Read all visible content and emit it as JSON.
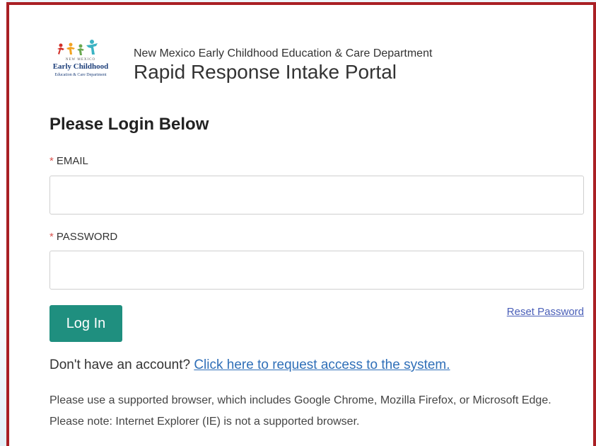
{
  "header": {
    "department": "New Mexico Early Childhood Education & Care Department",
    "portal_title": "Rapid Response Intake Portal",
    "logo": {
      "small_text": "NEW MEXICO",
      "main_text": "Early Childhood",
      "sub_text": "Education & Care Department"
    }
  },
  "login": {
    "heading": "Please Login Below",
    "required_marker": "*",
    "email_label": "EMAIL",
    "email_value": "",
    "password_label": "PASSWORD",
    "password_value": "",
    "login_button": "Log In",
    "reset_password": "Reset Password"
  },
  "account": {
    "prompt": "Don't have an account?",
    "request_link": "Click here to request access to the system."
  },
  "notice": {
    "browser_text": "Please use a supported browser, which includes Google Chrome, Mozilla Firefox, or Microsoft Edge. Please note: Internet Explorer (IE) is not a supported browser."
  },
  "colors": {
    "frame_border": "#a91f24",
    "button_bg": "#1f8f7f",
    "link": "#2f6fb8",
    "required": "#d9534f"
  }
}
